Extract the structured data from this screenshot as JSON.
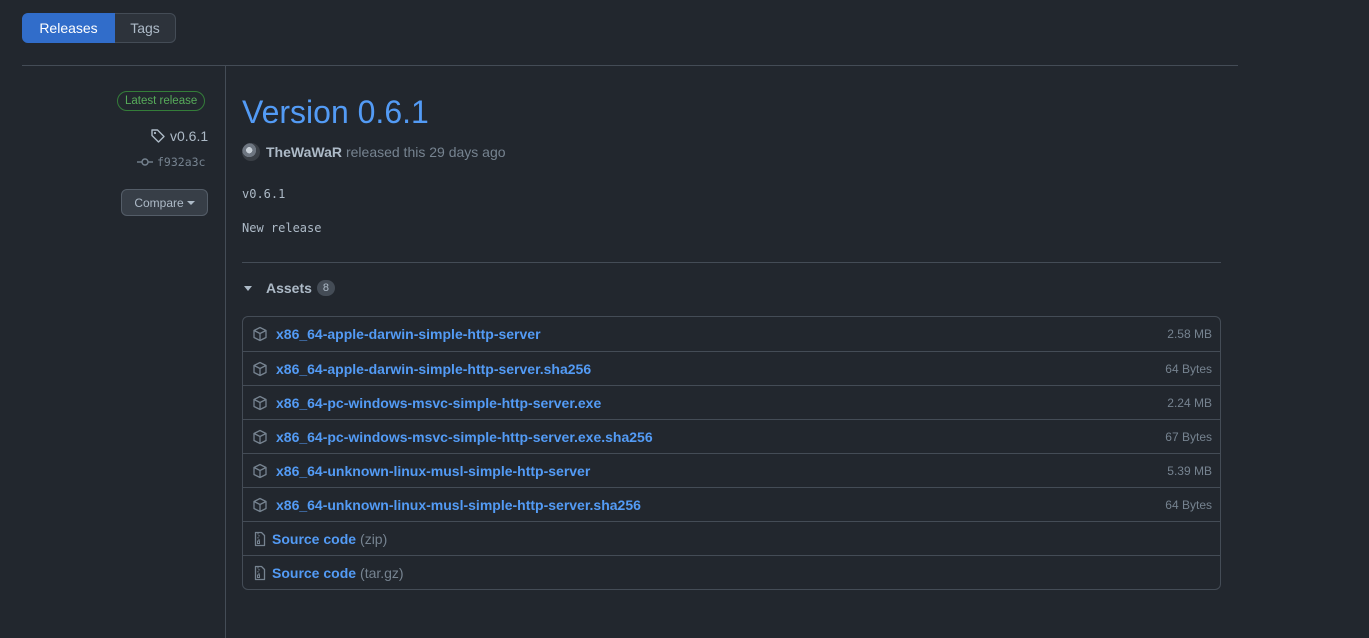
{
  "tabs": [
    {
      "label": "Releases"
    },
    {
      "label": "Tags"
    }
  ],
  "sidebar": {
    "badge": "Latest release",
    "tag": "v0.6.1",
    "commit": "f932a3c",
    "compare_label": "Compare"
  },
  "release": {
    "title": "Version 0.6.1",
    "author": "TheWaWaR",
    "released_text": "released this 29 days ago",
    "body_line1": "v0.6.1",
    "body_line2": "New release"
  },
  "assets": {
    "title": "Assets",
    "count": "8",
    "files": [
      {
        "name": "x86_64-apple-darwin-simple-http-server",
        "size": "2.58 MB"
      },
      {
        "name": "x86_64-apple-darwin-simple-http-server.sha256",
        "size": "64 Bytes"
      },
      {
        "name": "x86_64-pc-windows-msvc-simple-http-server.exe",
        "size": "2.24 MB"
      },
      {
        "name": "x86_64-pc-windows-msvc-simple-http-server.exe.sha256",
        "size": "67 Bytes"
      },
      {
        "name": "x86_64-unknown-linux-musl-simple-http-server",
        "size": "5.39 MB"
      },
      {
        "name": "x86_64-unknown-linux-musl-simple-http-server.sha256",
        "size": "64 Bytes"
      }
    ],
    "sources": [
      {
        "label": "Source code",
        "ext": "(zip)"
      },
      {
        "label": "Source code",
        "ext": "(tar.gz)"
      }
    ]
  },
  "icons": {
    "package": "package-icon",
    "zip": "file-zip-icon",
    "tag": "tag-icon",
    "commit": "git-commit-icon"
  },
  "colors": {
    "background": "#22272e",
    "accent": "#539bf5",
    "active_tab": "#316dca",
    "latest_badge": "#57ab5a"
  }
}
